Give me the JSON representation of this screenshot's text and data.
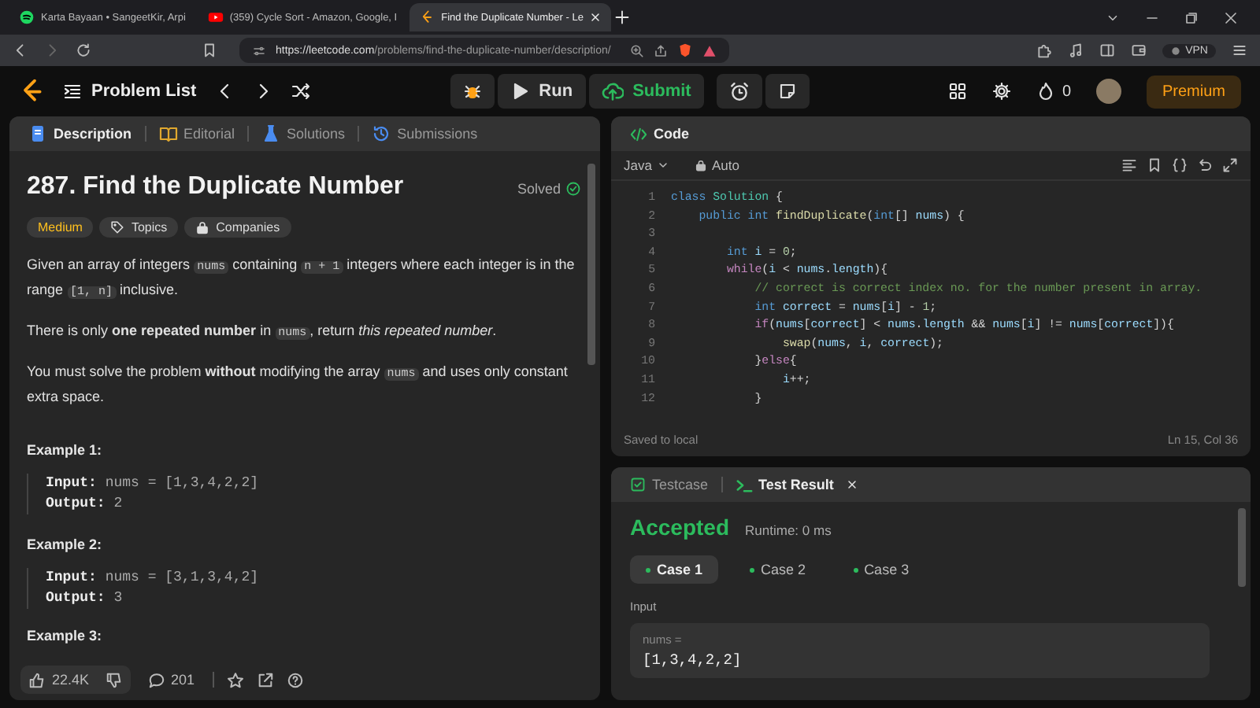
{
  "browser": {
    "tabs": [
      {
        "title": "Karta Bayaan • SangeetKir, Arpi",
        "kind": "audio",
        "selected": false
      },
      {
        "title": "(359) Cycle Sort - Amazon, Google, I",
        "kind": "video",
        "selected": false
      },
      {
        "title": "Find the Duplicate Number - Le",
        "kind": "page",
        "selected": true
      }
    ],
    "url_host": "https://leetcode.com",
    "url_path": "/problems/find-the-duplicate-number/description/",
    "vpn": "VPN"
  },
  "header": {
    "problem_list": "Problem List",
    "run": "Run",
    "submit": "Submit",
    "streak": "0",
    "premium": "Premium"
  },
  "left_tabs": [
    {
      "label": "Description",
      "kind": "description",
      "selected": true
    },
    {
      "label": "Editorial",
      "kind": "editorial",
      "selected": false
    },
    {
      "label": "Solutions",
      "kind": "solutions",
      "selected": false
    },
    {
      "label": "Submissions",
      "kind": "submissions",
      "selected": false
    }
  ],
  "problem": {
    "title": "287. Find the Duplicate Number",
    "status": "Solved",
    "difficulty": "Medium",
    "tags": [
      "Topics",
      "Companies"
    ],
    "paragraphs": [
      [
        {
          "kind": "text",
          "text": "Given an array of integers "
        },
        {
          "kind": "code",
          "text": "nums"
        },
        {
          "kind": "text",
          "text": " containing "
        },
        {
          "kind": "code",
          "text": "n + 1"
        },
        {
          "kind": "text",
          "text": " integers where each integer is in the range "
        },
        {
          "kind": "code",
          "text": "[1, n]"
        },
        {
          "kind": "text",
          "text": " inclusive."
        }
      ],
      [
        {
          "kind": "text",
          "text": "There is only **one repeated number** in "
        },
        {
          "kind": "code",
          "text": "nums"
        },
        {
          "kind": "text",
          "text": ", return *this repeated number*."
        }
      ],
      [
        {
          "kind": "text",
          "text": "You must solve the problem **without** modifying the array "
        },
        {
          "kind": "code",
          "text": "nums"
        },
        {
          "kind": "text",
          "text": " and uses only constant extra space."
        }
      ]
    ],
    "examples": [
      {
        "title": "Example 1:",
        "input_label": "Input:",
        "input": "nums = [1,3,4,2,2]",
        "output_label": "Output:",
        "output": "2"
      },
      {
        "title": "Example 2:",
        "input_label": "Input:",
        "input": "nums = [3,1,3,4,2]",
        "output_label": "Output:",
        "output": "3"
      }
    ],
    "next_heading": "Example 3:"
  },
  "footer": {
    "likes": "22.4K",
    "comments": "201"
  },
  "code": {
    "title": "Code",
    "language": "Java",
    "mode": "Auto",
    "saved": "Saved to local",
    "position": "Ln 15, Col 36",
    "lines": [
      {
        "number": "1",
        "tokens": [
          {
            "kind": "kw",
            "text": "class "
          },
          {
            "kind": "type",
            "text": "Solution"
          },
          {
            "kind": "plain",
            "text": " {"
          }
        ]
      },
      {
        "number": "2",
        "tokens": [
          {
            "kind": "kw",
            "text": "    public int "
          },
          {
            "kind": "fn",
            "text": "findDuplicate"
          },
          {
            "kind": "plain",
            "text": "("
          },
          {
            "kind": "kw",
            "text": "int"
          },
          {
            "kind": "plain",
            "text": "[] "
          },
          {
            "kind": "var",
            "text": "nums"
          },
          {
            "kind": "plain",
            "text": ") {"
          }
        ]
      },
      {
        "number": "3"
      },
      {
        "number": "4",
        "tokens": [
          {
            "kind": "kw",
            "text": "        int "
          },
          {
            "kind": "var",
            "text": "i"
          },
          {
            "kind": "plain",
            "text": " = "
          },
          {
            "kind": "num",
            "text": "0"
          },
          {
            "kind": "plain",
            "text": ";"
          }
        ]
      },
      {
        "number": "5",
        "tokens": [
          {
            "kind": "ctl",
            "text": "        while"
          },
          {
            "kind": "plain",
            "text": "("
          },
          {
            "kind": "var",
            "text": "i"
          },
          {
            "kind": "plain",
            "text": " < "
          },
          {
            "kind": "var",
            "text": "nums"
          },
          {
            "kind": "plain",
            "text": "."
          },
          {
            "kind": "var",
            "text": "length"
          },
          {
            "kind": "plain",
            "text": "){"
          }
        ]
      },
      {
        "number": "6",
        "tokens": [
          {
            "kind": "com",
            "text": "            // correct is correct index no. for the number present in array."
          }
        ]
      },
      {
        "number": "7",
        "tokens": [
          {
            "kind": "kw",
            "text": "            int "
          },
          {
            "kind": "var",
            "text": "correct"
          },
          {
            "kind": "plain",
            "text": " = "
          },
          {
            "kind": "var",
            "text": "nums"
          },
          {
            "kind": "plain",
            "text": "["
          },
          {
            "kind": "var",
            "text": "i"
          },
          {
            "kind": "plain",
            "text": "] - "
          },
          {
            "kind": "num",
            "text": "1"
          },
          {
            "kind": "plain",
            "text": ";"
          }
        ]
      },
      {
        "number": "8",
        "tokens": [
          {
            "kind": "ctl",
            "text": "            if"
          },
          {
            "kind": "plain",
            "text": "("
          },
          {
            "kind": "var",
            "text": "nums"
          },
          {
            "kind": "plain",
            "text": "["
          },
          {
            "kind": "var",
            "text": "correct"
          },
          {
            "kind": "plain",
            "text": "] < "
          },
          {
            "kind": "var",
            "text": "nums"
          },
          {
            "kind": "plain",
            "text": "."
          },
          {
            "kind": "var",
            "text": "length"
          },
          {
            "kind": "plain",
            "text": " && "
          },
          {
            "kind": "var",
            "text": "nums"
          },
          {
            "kind": "plain",
            "text": "["
          },
          {
            "kind": "var",
            "text": "i"
          },
          {
            "kind": "plain",
            "text": "] != "
          },
          {
            "kind": "var",
            "text": "nums"
          },
          {
            "kind": "plain",
            "text": "["
          },
          {
            "kind": "var",
            "text": "correct"
          },
          {
            "kind": "plain",
            "text": "]){"
          }
        ]
      },
      {
        "number": "9",
        "tokens": [
          {
            "kind": "fn",
            "text": "                swap"
          },
          {
            "kind": "plain",
            "text": "("
          },
          {
            "kind": "var",
            "text": "nums"
          },
          {
            "kind": "plain",
            "text": ", "
          },
          {
            "kind": "var",
            "text": "i"
          },
          {
            "kind": "plain",
            "text": ", "
          },
          {
            "kind": "var",
            "text": "correct"
          },
          {
            "kind": "plain",
            "text": ");"
          }
        ]
      },
      {
        "number": "10",
        "tokens": [
          {
            "kind": "plain",
            "text": "            }"
          },
          {
            "kind": "ctl",
            "text": "else"
          },
          {
            "kind": "plain",
            "text": "{"
          }
        ]
      },
      {
        "number": "11",
        "tokens": [
          {
            "kind": "var",
            "text": "                i"
          },
          {
            "kind": "plain",
            "text": "++;"
          }
        ]
      },
      {
        "number": "12",
        "tokens": [
          {
            "kind": "plain",
            "text": "            }"
          }
        ]
      }
    ]
  },
  "test": {
    "tabs": [
      {
        "label": "Testcase",
        "kind": "testcase",
        "selected": false
      },
      {
        "label": "Test Result",
        "kind": "result",
        "selected": true
      }
    ],
    "verdict": "Accepted",
    "runtime": "Runtime: 0 ms",
    "cases": [
      {
        "label": "Case 1",
        "selected": true
      },
      {
        "label": "Case 2",
        "selected": false
      },
      {
        "label": "Case 3",
        "selected": false
      }
    ],
    "input_label": "Input",
    "var_label": "nums =",
    "value": "[1,3,4,2,2]"
  }
}
